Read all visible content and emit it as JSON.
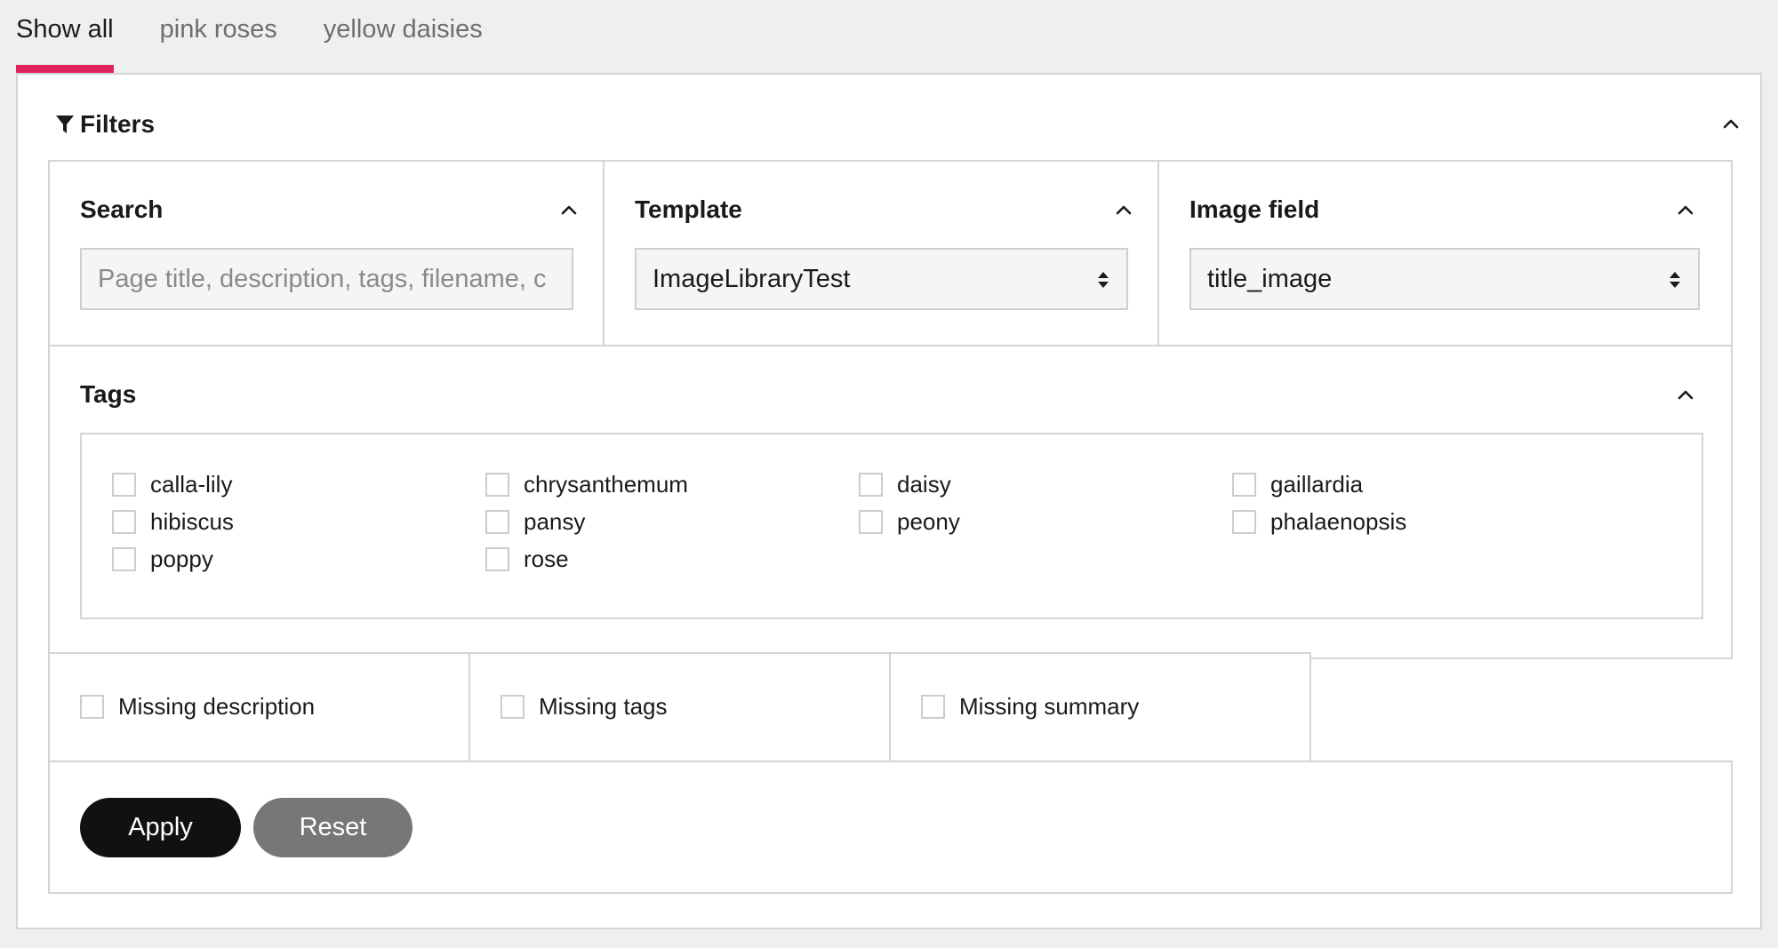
{
  "tabs": [
    {
      "label": "Show all",
      "active": true
    },
    {
      "label": "pink roses",
      "active": false
    },
    {
      "label": "yellow daisies",
      "active": false
    }
  ],
  "accent_color": "#e0245e",
  "filters": {
    "title": "Filters",
    "search": {
      "title": "Search",
      "placeholder": "Page title, description, tags, filename, c",
      "value": ""
    },
    "template": {
      "title": "Template",
      "selected": "ImageLibraryTest"
    },
    "image_field": {
      "title": "Image field",
      "selected": "title_image"
    },
    "tags": {
      "title": "Tags",
      "items": [
        {
          "label": "calla-lily",
          "checked": false
        },
        {
          "label": "chrysanthemum",
          "checked": false
        },
        {
          "label": "daisy",
          "checked": false
        },
        {
          "label": "gaillardia",
          "checked": false
        },
        {
          "label": "hibiscus",
          "checked": false
        },
        {
          "label": "pansy",
          "checked": false
        },
        {
          "label": "peony",
          "checked": false
        },
        {
          "label": "phalaenopsis",
          "checked": false
        },
        {
          "label": "poppy",
          "checked": false
        },
        {
          "label": "rose",
          "checked": false
        }
      ]
    },
    "missing": [
      {
        "label": "Missing description",
        "checked": false
      },
      {
        "label": "Missing tags",
        "checked": false
      },
      {
        "label": "Missing summary",
        "checked": false
      }
    ],
    "apply_label": "Apply",
    "reset_label": "Reset"
  }
}
